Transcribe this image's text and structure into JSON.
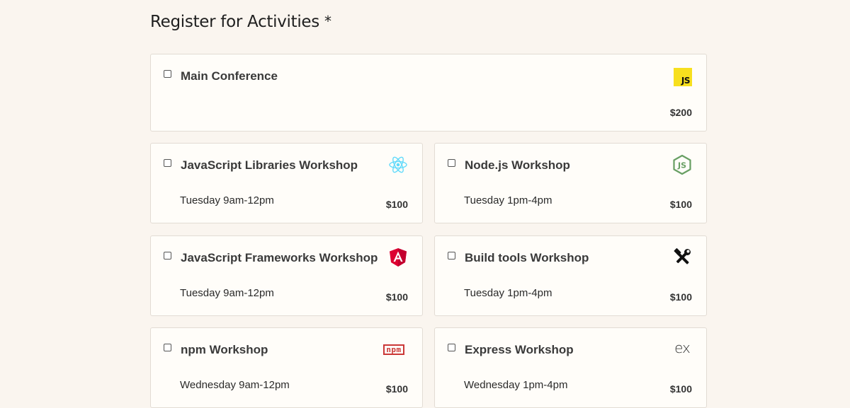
{
  "heading": {
    "title": "Register for Activities",
    "required_mark": "*"
  },
  "activities": [
    {
      "id": "main",
      "name": "Main Conference",
      "time": "",
      "price": "$200",
      "logo": "javascript-icon",
      "logo_color": "#f7df1e",
      "logo_text": "JS",
      "checked": false
    },
    {
      "id": "js-libs",
      "name": "JavaScript Libraries Workshop",
      "time": "Tuesday 9am-12pm",
      "price": "$100",
      "logo": "react-icon",
      "logo_color": "#61dafb",
      "checked": false
    },
    {
      "id": "node",
      "name": "Node.js Workshop",
      "time": "Tuesday 1pm-4pm",
      "price": "$100",
      "logo": "nodejs-icon",
      "logo_color": "#689f63",
      "checked": false
    },
    {
      "id": "js-frameworks",
      "name": "JavaScript Frameworks Workshop",
      "time": "Tuesday 9am-12pm",
      "price": "$100",
      "logo": "angular-icon",
      "logo_color": "#dd0031",
      "checked": false
    },
    {
      "id": "build-tools",
      "name": "Build tools Workshop",
      "time": "Tuesday 1pm-4pm",
      "price": "$100",
      "logo": "build-tools-icon",
      "logo_color": "#111111",
      "checked": false
    },
    {
      "id": "npm",
      "name": "npm Workshop",
      "time": "Wednesday 9am-12pm",
      "price": "$100",
      "logo": "npm-icon",
      "logo_color": "#cb3837",
      "logo_text": "npm",
      "checked": false
    },
    {
      "id": "express",
      "name": "Express Workshop",
      "time": "Wednesday 1pm-4pm",
      "price": "$100",
      "logo": "express-icon",
      "logo_color": "#333333",
      "logo_text": "ex",
      "checked": false
    }
  ],
  "colors": {
    "background": "#faf5ef",
    "card": "#fffdf9",
    "border": "#e2dcd4"
  }
}
